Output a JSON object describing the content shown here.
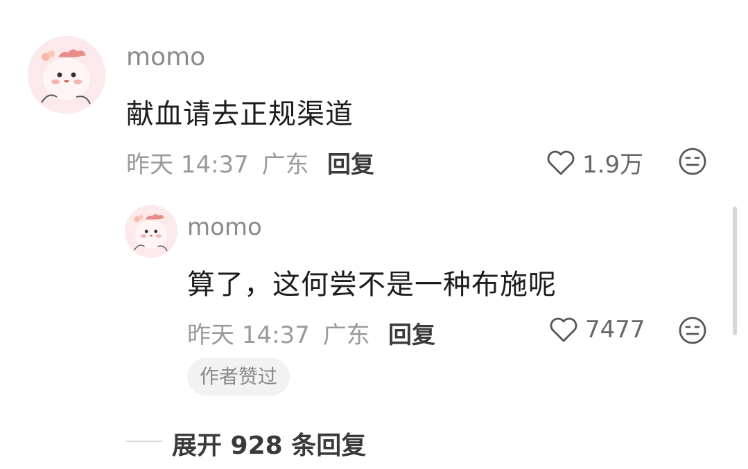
{
  "comment": {
    "username": "momo",
    "text": "献血请去正规渠道",
    "time": "昨天 14:37",
    "location": "广东",
    "reply_label": "回复",
    "likes": "1.9万",
    "like_icon": "heart-outline-icon",
    "dislike_icon": "meh-face-icon"
  },
  "reply": {
    "username": "momo",
    "text": "算了，这何尝不是一种布施呢",
    "time": "昨天 14:37",
    "location": "广东",
    "reply_label": "回复",
    "likes": "7477",
    "like_icon": "heart-outline-icon",
    "dislike_icon": "meh-face-icon",
    "badge": "作者赞过"
  },
  "expand": {
    "label": "展开 928 条回复"
  }
}
